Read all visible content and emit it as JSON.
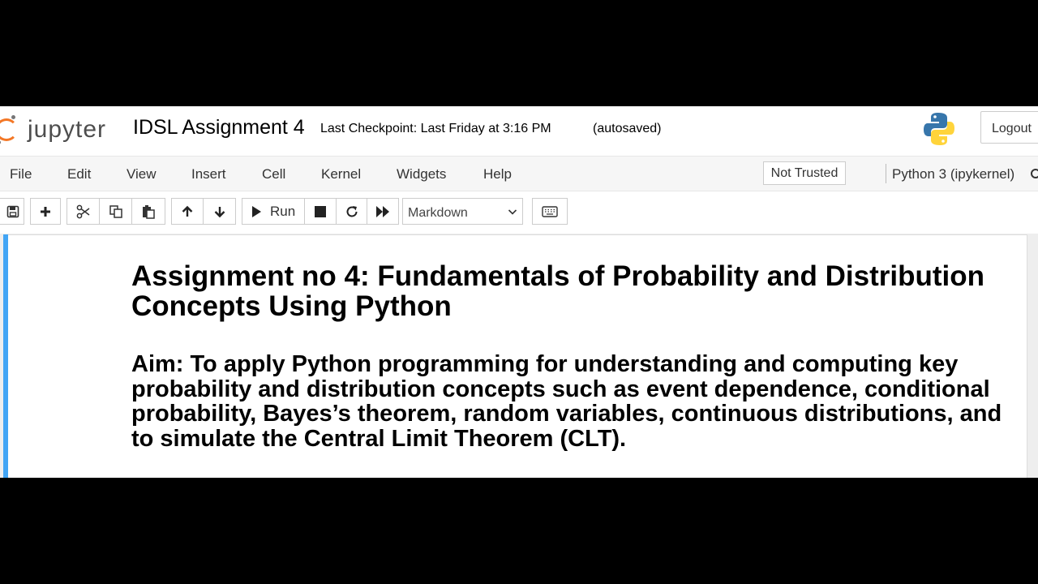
{
  "header": {
    "logo_text": "jupyter",
    "notebook_name": "IDSL Assignment 4",
    "checkpoint": "Last Checkpoint: Last Friday at 3:16 PM",
    "autosave": "(autosaved)",
    "logout_label": "Logout",
    "kernel_logo_icon": "python-logo-icon"
  },
  "menubar": {
    "items": [
      "File",
      "Edit",
      "View",
      "Insert",
      "Cell",
      "Kernel",
      "Widgets",
      "Help"
    ],
    "trust_label": "Not Trusted",
    "kernel_name": "Python 3 (ipykernel)"
  },
  "toolbar": {
    "run_label": "Run",
    "cell_type": "Markdown",
    "icons": [
      "save-icon",
      "plus-icon",
      "cut-icon",
      "copy-icon",
      "paste-icon",
      "arrow-up-icon",
      "arrow-down-icon",
      "play-icon",
      "stop-icon",
      "restart-icon",
      "fast-forward-icon",
      "keyboard-icon"
    ]
  },
  "cell": {
    "heading": "Assignment no 4: Fundamentals of Probability and Distribution Concepts Using Python",
    "aim": "Aim: To apply Python programming for understanding and computing key probability and distribution concepts such as event dependence, conditional probability, Bayes’s theorem, random variables, continuous distributions, and to simulate the Central Limit Theorem (CLT)."
  },
  "colors": {
    "jupyter_orange": "#f37726",
    "cell_selected_bar": "#42a5f5",
    "python_blue": "#3776ab",
    "python_yellow": "#ffd43b"
  }
}
